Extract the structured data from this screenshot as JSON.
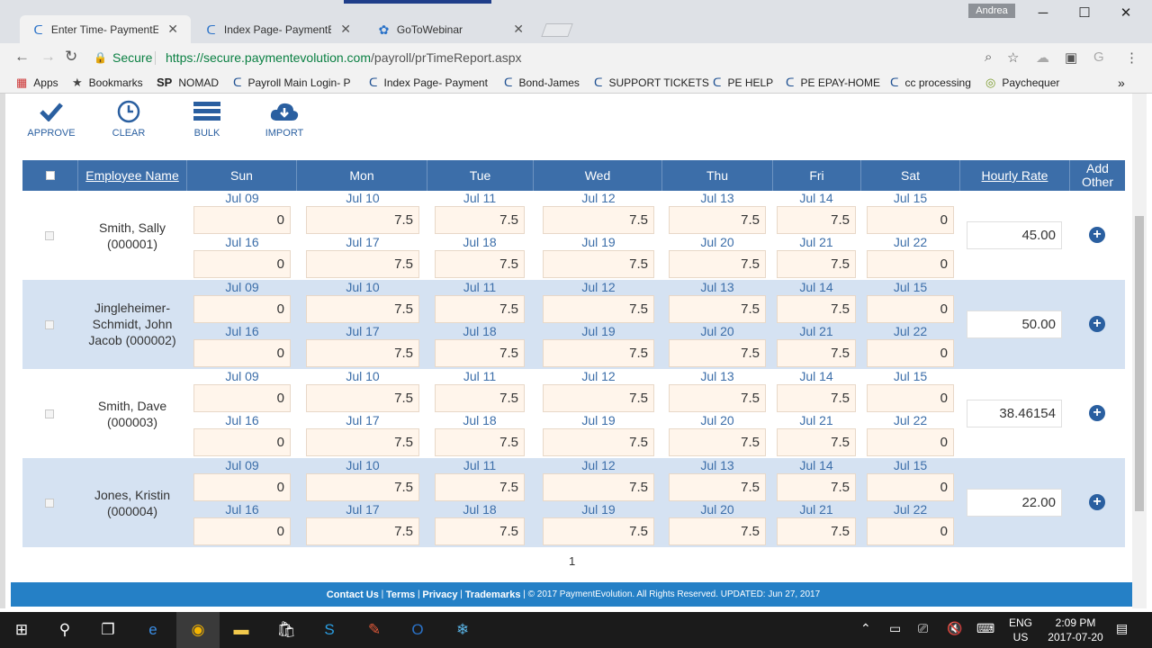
{
  "tabs": [
    {
      "title": "Enter Time- PaymentEvol",
      "active": true
    },
    {
      "title": "Index Page- PaymentEvol",
      "active": false
    },
    {
      "title": "GoToWebinar",
      "active": false
    }
  ],
  "profile_name": "Andrea",
  "address": {
    "secure_label": "Secure",
    "url_host": "https://secure.paymentevolution.com",
    "url_path": "/payroll/prTimeReport.aspx"
  },
  "bookmarks": [
    "Apps",
    "Bookmarks",
    "NOMAD",
    "Payroll Main Login- P",
    "Index Page- Payment",
    "Bond-James",
    "SUPPORT TICKETS",
    "PE HELP",
    "PE EPAY-HOME",
    "cc processing",
    "Paychequer"
  ],
  "actions": {
    "approve": "APPROVE",
    "clear": "CLEAR",
    "bulk": "BULK",
    "import": "IMPORT"
  },
  "table": {
    "headers": {
      "employee": "Employee Name",
      "days": [
        "Sun",
        "Mon",
        "Tue",
        "Wed",
        "Thu",
        "Fri",
        "Sat"
      ],
      "rate": "Hourly Rate",
      "add": "Add Other"
    },
    "week1_dates": [
      "Jul 09",
      "Jul 10",
      "Jul 11",
      "Jul 12",
      "Jul 13",
      "Jul 14",
      "Jul 15"
    ],
    "week2_dates": [
      "Jul 16",
      "Jul 17",
      "Jul 18",
      "Jul 19",
      "Jul 20",
      "Jul 21",
      "Jul 22"
    ],
    "rows": [
      {
        "name": "Smith, Sally (000001)",
        "week1": [
          "0",
          "7.5",
          "7.5",
          "7.5",
          "7.5",
          "7.5",
          "0"
        ],
        "week2": [
          "0",
          "7.5",
          "7.5",
          "7.5",
          "7.5",
          "7.5",
          "0"
        ],
        "rate": "45.00"
      },
      {
        "name": "Jingleheimer-Schmidt, John Jacob (000002)",
        "week1": [
          "0",
          "7.5",
          "7.5",
          "7.5",
          "7.5",
          "7.5",
          "0"
        ],
        "week2": [
          "0",
          "7.5",
          "7.5",
          "7.5",
          "7.5",
          "7.5",
          "0"
        ],
        "rate": "50.00"
      },
      {
        "name": "Smith, Dave (000003)",
        "week1": [
          "0",
          "7.5",
          "7.5",
          "7.5",
          "7.5",
          "7.5",
          "0"
        ],
        "week2": [
          "0",
          "7.5",
          "7.5",
          "7.5",
          "7.5",
          "7.5",
          "0"
        ],
        "rate": "38.46154"
      },
      {
        "name": "Jones, Kristin (000004)",
        "week1": [
          "0",
          "7.5",
          "7.5",
          "7.5",
          "7.5",
          "7.5",
          "0"
        ],
        "week2": [
          "0",
          "7.5",
          "7.5",
          "7.5",
          "7.5",
          "7.5",
          "0"
        ],
        "rate": "22.00"
      }
    ]
  },
  "pager": "1",
  "footer": {
    "links": [
      "Contact Us",
      "Terms",
      "Privacy",
      "Trademarks"
    ],
    "copyright": "© 2017 PaymentEvolution. All Rights Reserved. UPDATED: Jun 27, 2017"
  },
  "taskbar": {
    "lang": "ENG",
    "region": "US",
    "time": "2:09 PM",
    "date": "2017-07-20"
  },
  "colors": {
    "header_blue": "#3c6ea9",
    "alt_row": "#d5e2f2",
    "cell_bg": "#fff5eb",
    "footer": "#2580c6"
  }
}
